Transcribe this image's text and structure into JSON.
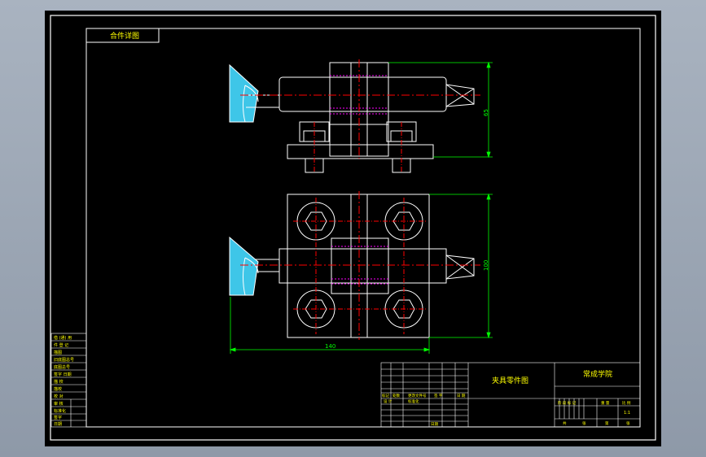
{
  "drawing": {
    "header_tag": "合件详图",
    "dimensions": {
      "top_height": "65",
      "bottom_height": "100",
      "bottom_width": "140"
    }
  },
  "title_block": {
    "drawing_name": "夹具零件图",
    "school": "常成学院",
    "scale": "1:1",
    "revision_header": [
      "标记",
      "处数",
      "更改文件号",
      "签 字",
      "日 期"
    ],
    "design_row": [
      "设 计",
      "",
      "标准化"
    ],
    "weight_header": [
      "阶 段 标 记",
      "重 量",
      "比 例"
    ],
    "bottom_row": [
      "共",
      "张",
      "第",
      "张"
    ],
    "approve_label": "日期"
  },
  "side_table": {
    "rows": [
      "借 (通) 用",
      "件 登 记",
      "描图",
      "旧底图总号",
      "底图总号",
      "签字 日期",
      "描 校",
      "描校",
      "校 对",
      "审 核",
      "标准化",
      "签字",
      "日期"
    ]
  },
  "colors": {
    "background": "#000000",
    "frame": "#ffffff",
    "outline": "#ffffff",
    "center_line": "#ff0000",
    "dimension": "#00ff00",
    "hidden_line": "#ff00ff",
    "hatch": "#3ec6e8",
    "title_text": "#ffff00"
  }
}
